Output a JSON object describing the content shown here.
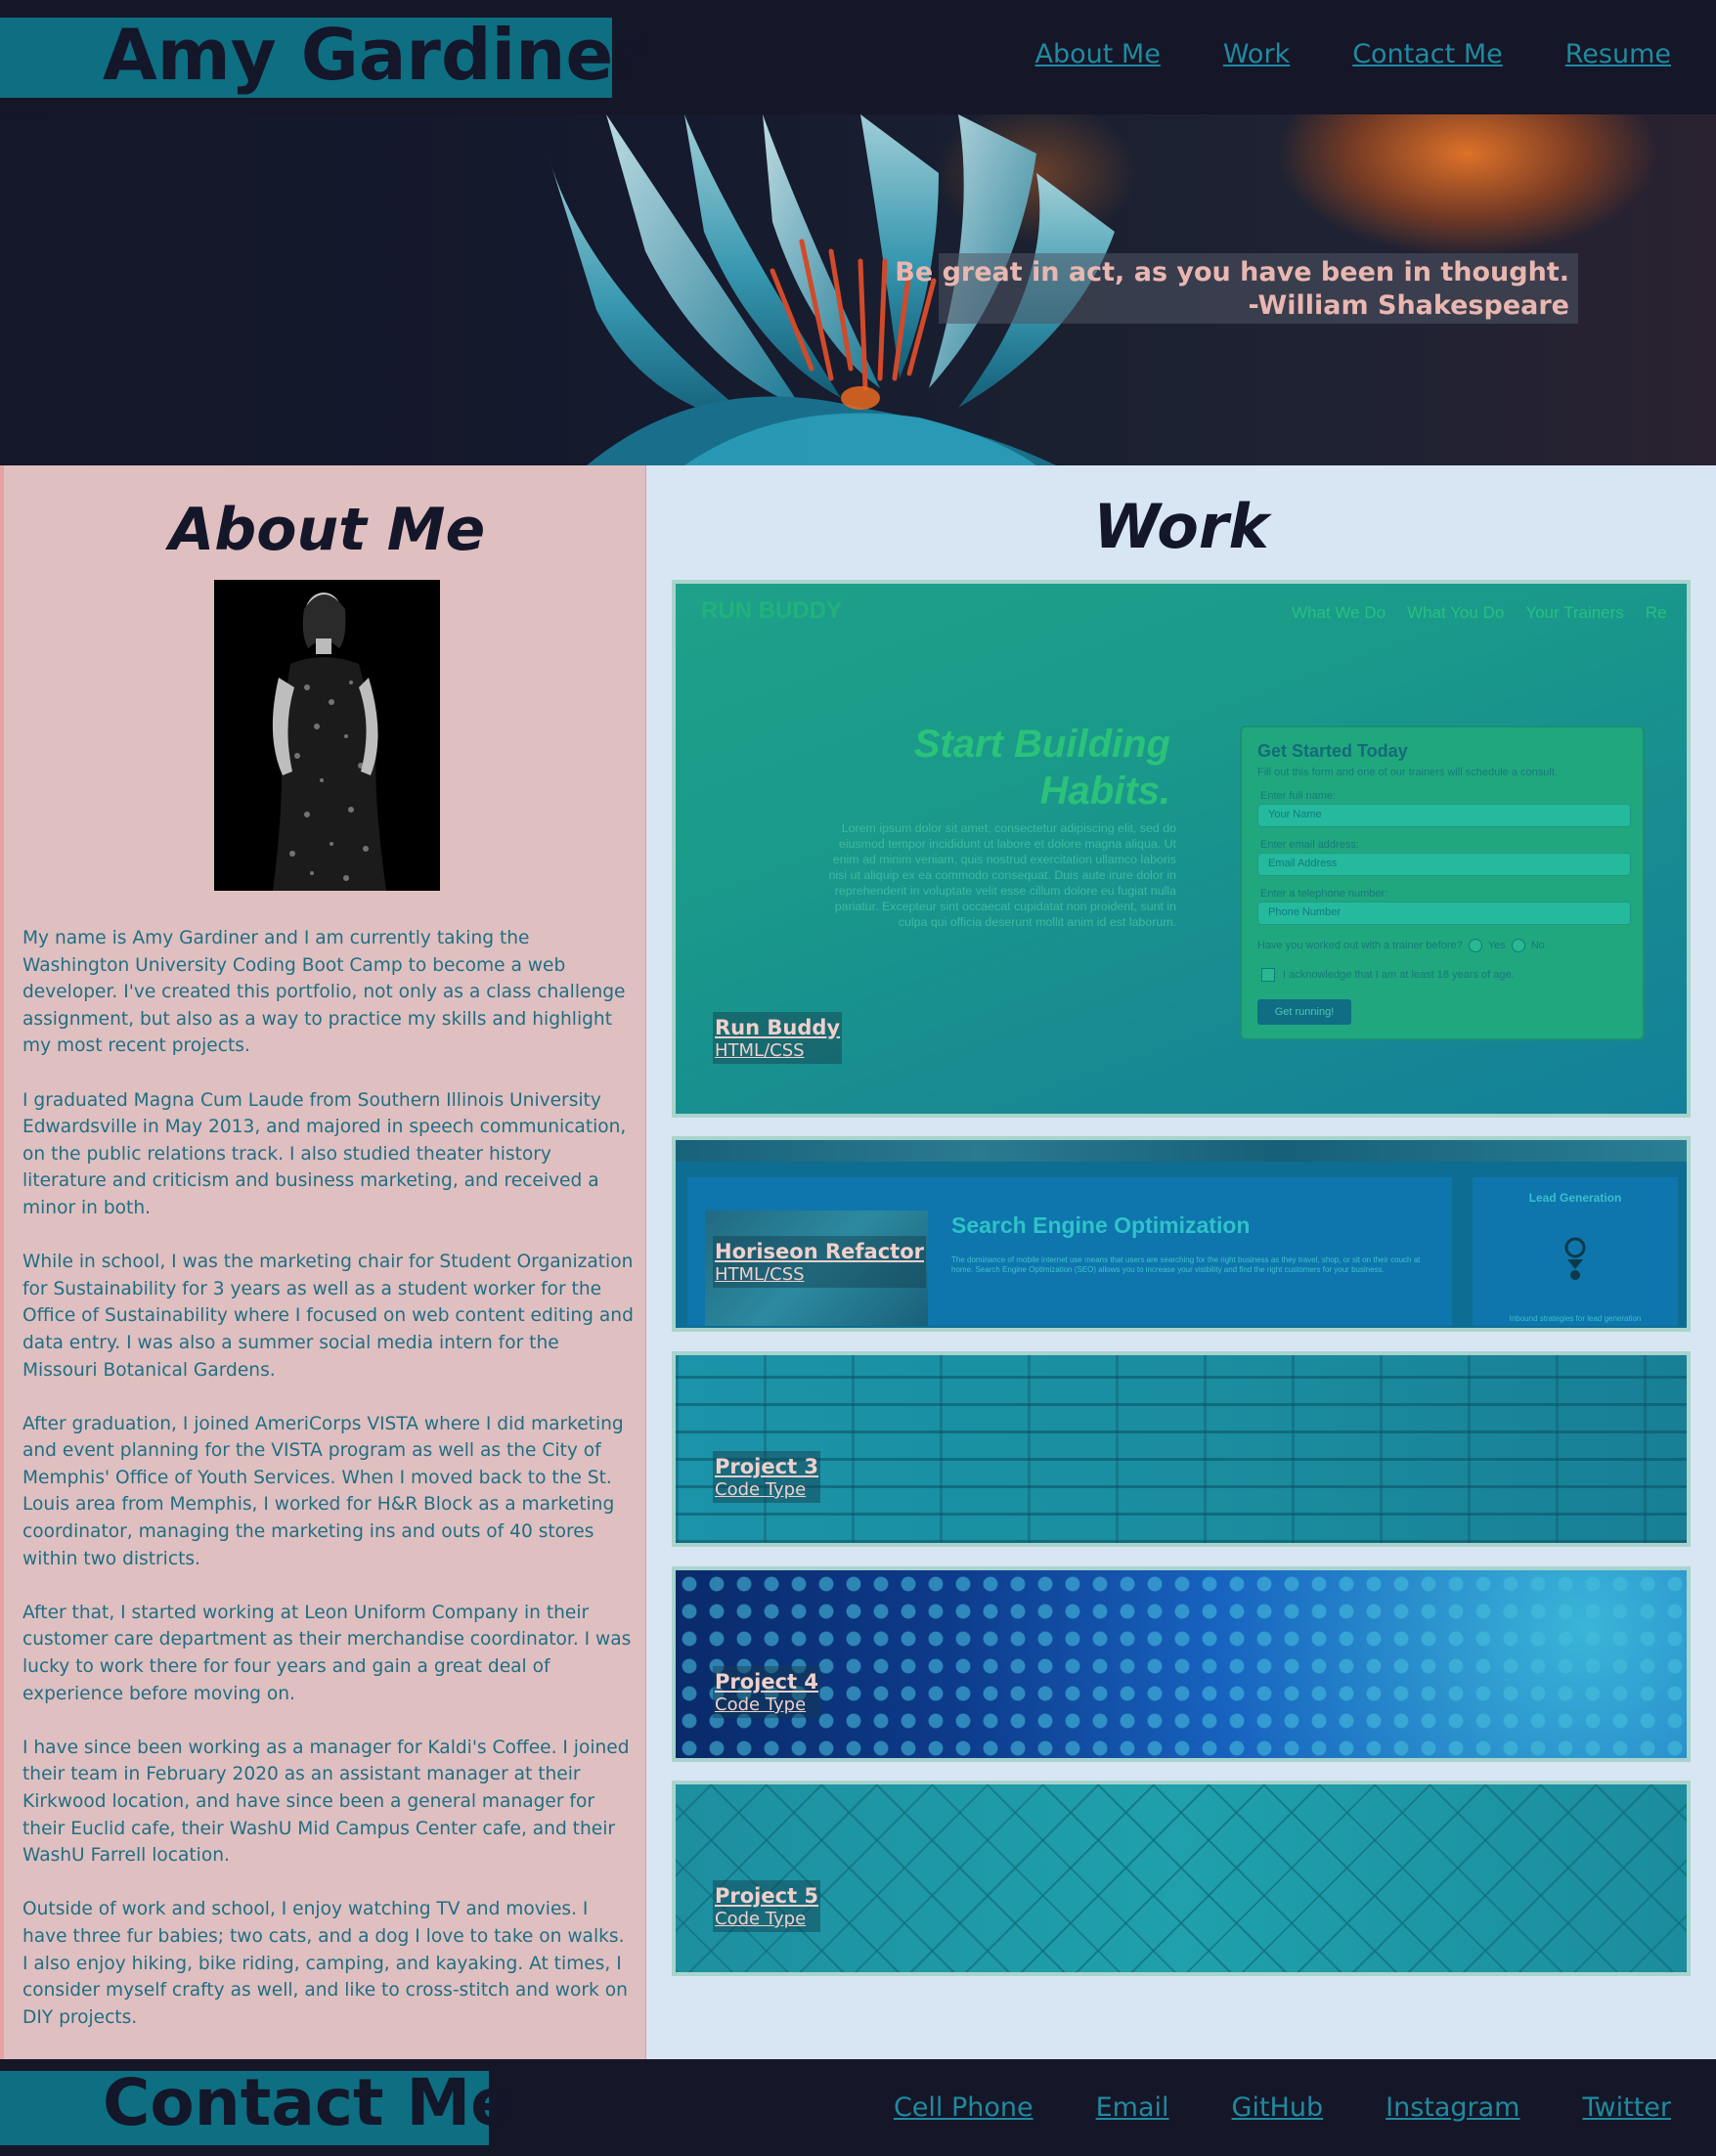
{
  "header": {
    "name": "Amy Gardiner",
    "nav": [
      "About Me",
      "Work",
      "Contact Me",
      "Resume"
    ]
  },
  "hero": {
    "quote_line1": "Be great in act, as you have been in thought.",
    "quote_line2": "-William Shakespeare"
  },
  "about": {
    "heading": "About Me",
    "paragraphs": [
      "My name is Amy Gardiner and I am currently taking the Washington University Coding Boot Camp to become a web developer. I've created this portfolio, not only as a class challenge assignment, but also as a way to practice my skills and highlight my most recent projects.",
      "I graduated Magna Cum Laude from Southern Illinois University Edwardsville in May 2013, and majored in speech communication, on the public relations track. I also studied theater history literature and criticism and business marketing, and received a minor in both.",
      "While in school, I was the marketing chair for Student Organization for Sustainability for 3 years as well as a student worker for the Office of Sustainability where I focused on web content editing and data entry. I was also a summer social media intern for the Missouri Botanical Gardens.",
      "After graduation, I joined AmeriCorps VISTA where I did marketing and event planning for the VISTA program as well as the City of Memphis' Office of Youth Services. When I moved back to the St. Louis area from Memphis, I worked for H&R Block as a marketing coordinator, managing the marketing ins and outs of 40 stores within two districts.",
      "After that, I started working at Leon Uniform Company in their customer care department as their merchandise coordinator. I was lucky to work there for four years and gain a great deal of experience before moving on.",
      "I have since been working as a manager for Kaldi's Coffee. I joined their team in February 2020 as an assistant manager at their Kirkwood location, and have since been a general manager for their Euclid cafe, their WashU Mid Campus Center cafe, and their WashU Farrell location.",
      "Outside of work and school, I enjoy watching TV and movies. I have three fur babies; two cats, and a dog I love to take on walks. I also enjoy hiking, bike riding, camping, and kayaking. At times, I consider myself crafty as well, and like to cross-stitch and work on DIY projects."
    ]
  },
  "work": {
    "heading": "Work",
    "projects": [
      {
        "title": "Run Buddy",
        "type": "HTML/CSS"
      },
      {
        "title": "Horiseon Refactor",
        "type": "HTML/CSS"
      },
      {
        "title": "Project 3",
        "type": "Code Type"
      },
      {
        "title": "Project 4",
        "type": "Code Type"
      },
      {
        "title": "Project 5",
        "type": "Code Type"
      }
    ],
    "runbuddy_preview": {
      "logo": "RUN BUDDY",
      "nav": [
        "What We Do",
        "What You Do",
        "Your Trainers",
        "Re"
      ],
      "headline_line1": "Start Building",
      "headline_line2": "Habits.",
      "lorem": "Lorem ipsum dolor sit amet, consectetur adipiscing elit, sed do eiusmod tempor incididunt ut labore et dolore magna aliqua. Ut enim ad minim veniam, quis nostrud exercitation ullamco laboris nisi ut aliquip ex ea commodo consequat. Duis aute irure dolor in reprehenderit in voluptate velit esse cillum dolore eu fugiat nulla pariatur. Excepteur sint occaecat cupidatat non proident, sunt in culpa qui officia deserunt mollit anim id est laborum.",
      "form_title": "Get Started Today",
      "form_sub": "Fill out this form and one of our trainers will schedule a consult.",
      "label_name": "Enter full name:",
      "ph_name": "Your Name",
      "label_email": "Enter email address:",
      "ph_email": "Email Address",
      "label_phone": "Enter a telephone number:",
      "ph_phone": "Phone Number",
      "radio_q": "Have you worked out with a trainer before?",
      "yes": "Yes",
      "no": "No",
      "ack": "I acknowledge that I am at least 18 years of age.",
      "button": "Get running!"
    },
    "horiseon_preview": {
      "heading": "Search Engine Optimization",
      "text": "The dominance of mobile internet use means that users are searching for the right business as they travel, shop, or sit on their couch at home. Search Engine Optimization (SEO) allows you to increase your visibility and find the right customers for your business.",
      "side_title": "Lead Generation",
      "side_text": "Inbound strategies for lead generation"
    }
  },
  "footer": {
    "heading": "Contact Me",
    "links": [
      "Cell Phone",
      "Email",
      "GitHub",
      "Instagram",
      "Twitter"
    ]
  },
  "colors": {
    "background": "#141629",
    "accent_teal": "#0e6e82",
    "link": "#1f8aa0",
    "about_bg": "#e0bfc0",
    "work_bg": "#d8e6f4",
    "quote_text": "#e9b7b0"
  }
}
